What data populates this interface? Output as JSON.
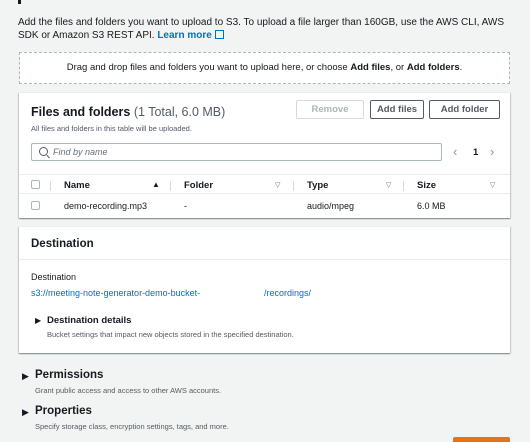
{
  "intro": {
    "text": "Add the files and folders you want to upload to S3. To upload a file larger than 160GB, use the AWS CLI, AWS SDK or Amazon S3 REST API.",
    "learn_more": "Learn more"
  },
  "dropzone": {
    "prefix": "Drag and drop files and folders you want to upload here, or choose ",
    "add_files": "Add files",
    "middle": ", or ",
    "add_folders": "Add folders",
    "suffix": "."
  },
  "files_panel": {
    "title": "Files and folders",
    "count": "(1 Total, 6.0 MB)",
    "description": "All files and folders in this table will be uploaded.",
    "remove_label": "Remove",
    "add_files_label": "Add files",
    "add_folder_label": "Add folder",
    "search_placeholder": "Find by name",
    "page": "1",
    "columns": {
      "name": "Name",
      "folder": "Folder",
      "type": "Type",
      "size": "Size"
    },
    "rows": [
      {
        "name": "demo-recording.mp3",
        "folder": "-",
        "type": "audio/mpeg",
        "size": "6.0 MB"
      }
    ]
  },
  "destination": {
    "heading": "Destination",
    "label": "Destination",
    "bucket_link": "s3://meeting-note-generator-demo-bucket-",
    "path_link": "/recordings/",
    "details_title": "Destination details",
    "details_desc": "Bucket settings that impact new objects stored in the specified destination."
  },
  "permissions": {
    "title": "Permissions",
    "desc": "Grant public access and access to other AWS accounts."
  },
  "properties": {
    "title": "Properties",
    "desc": "Specify storage class, encryption settings, tags, and more."
  },
  "colors": {
    "link": "#0073bb",
    "primary_button": "#ec7211",
    "background": "#f2f3f3"
  }
}
